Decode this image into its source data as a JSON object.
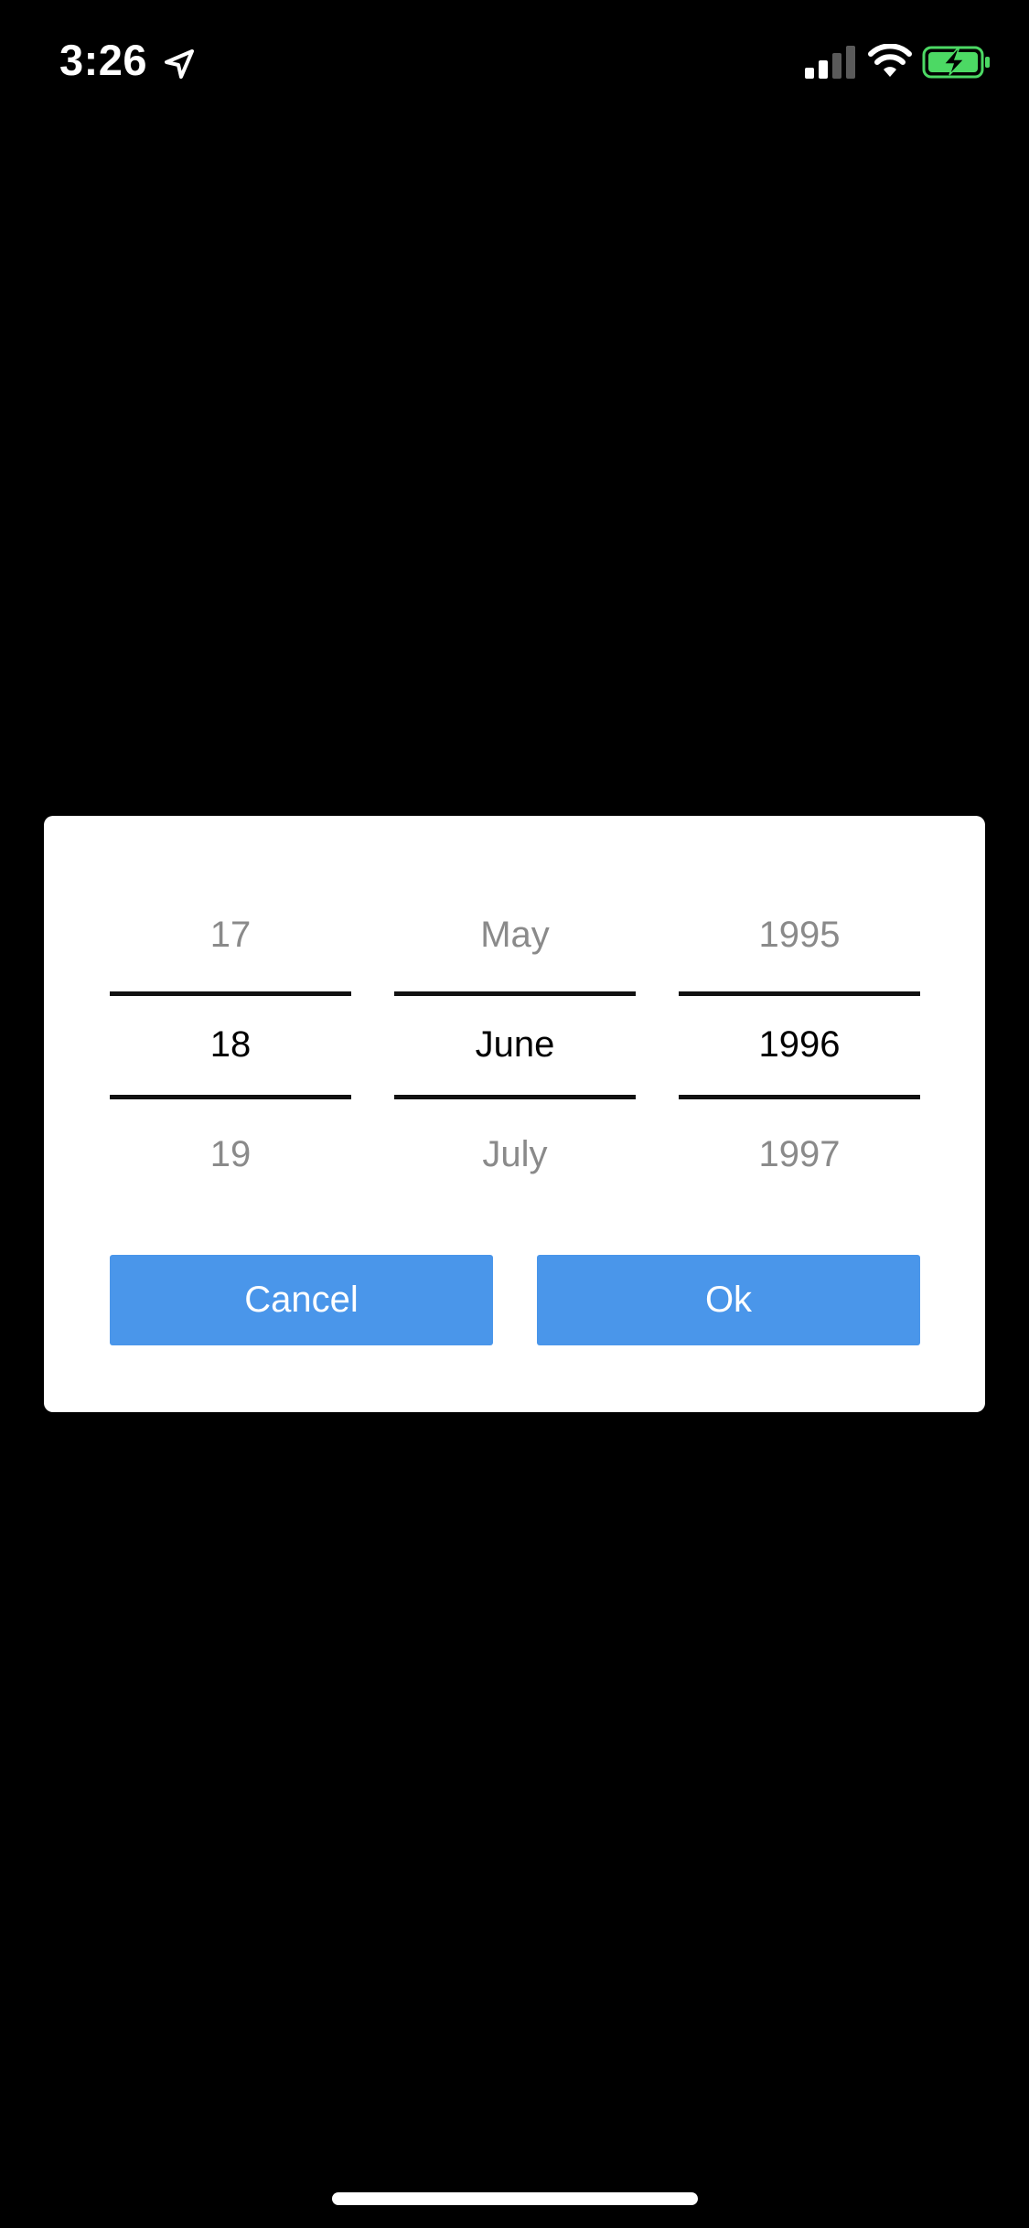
{
  "status_bar": {
    "time": "3:26",
    "location_icon": "location-arrow-icon",
    "signal_icon": "cellular-signal-icon",
    "wifi_icon": "wifi-icon",
    "battery_icon": "battery-charging-icon",
    "battery_color": "#4cd964"
  },
  "date_picker": {
    "day": {
      "prev": "17",
      "selected": "18",
      "next": "19"
    },
    "month": {
      "prev": "May",
      "selected": "June",
      "next": "July"
    },
    "year": {
      "prev": "1995",
      "selected": "1996",
      "next": "1997"
    }
  },
  "buttons": {
    "cancel_label": "Cancel",
    "ok_label": "Ok",
    "accent_color": "#4a96ea"
  }
}
